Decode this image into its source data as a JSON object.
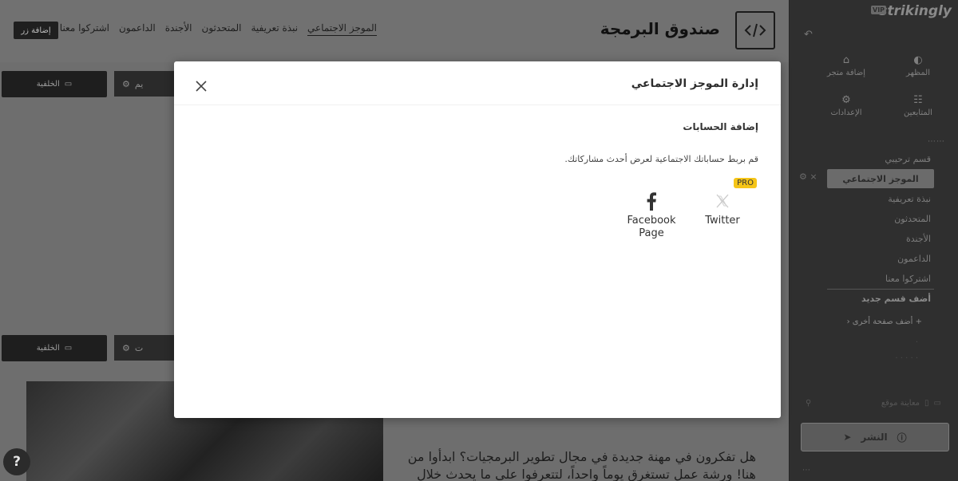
{
  "site": {
    "brand_title": "صندوق البرمجة",
    "add_button": "إضافة زر",
    "nav": [
      "الموجز الاجتماعي",
      "نبذة تعريفية",
      "المتحدثون",
      "الأجندة",
      "الداعمون",
      "اشتركوا معنا"
    ],
    "section_controls": {
      "background_label": "الخلفية",
      "style_label_top": "يم",
      "style_label_bottom": "ت"
    },
    "hero_text": "هل تفكرون في مهنة جديدة في مجال تطوير البرمجيات؟ ابدأوا من هنا! ورشة عمل تستغرق يوماً واحداً، لتتعرفوا على ما يحدث خلال",
    "help_label": "?"
  },
  "sidebar": {
    "logo": "strikingly",
    "vip_badge": "VIP",
    "back_icon": "undo-icon",
    "tiles": [
      {
        "label": "المظهر",
        "icon": "palette-icon"
      },
      {
        "label": "إضافة متجر",
        "icon": "store-icon"
      },
      {
        "label": "المتابعين",
        "icon": "people-icon"
      },
      {
        "label": "الإعدادات",
        "icon": "gear-icon"
      }
    ],
    "sections": [
      "قسم ترحيبي",
      "الموجز الاجتماعي",
      "نبذة تعريفية",
      "المتحدثون",
      "الأجندة",
      "الداعمون",
      "اشتركوا معنا"
    ],
    "active_section": "الموجز الاجتماعي",
    "add_section": "أضف قسم جديد",
    "add_page": "أضف صفحة أخرى",
    "search_placeholder": "معاينة موقع",
    "publish_label": "النشر"
  },
  "modal": {
    "title": "إدارة الموجز الاجتماعي",
    "section_heading": "إضافة الحسابات",
    "description": "قم بربط حساباتك الاجتماعية لعرض أحدث مشاركاتك.",
    "pro_badge": "PRO",
    "accounts": [
      {
        "label_line1": "Facebook",
        "label_line2": "Page",
        "icon": "facebook-icon"
      },
      {
        "label_line1": "Twitter",
        "label_line2": "",
        "icon": "twitter-icon"
      }
    ]
  },
  "colors": {
    "overlay_dim": "#6e6e6e",
    "sidebar_bg": "#2f2f2f",
    "modal_bg": "#ffffff",
    "pro_badge": "#f5c518"
  }
}
